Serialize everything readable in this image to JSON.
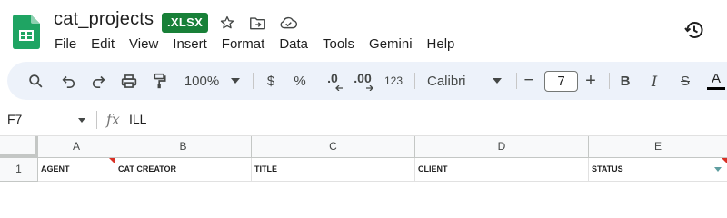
{
  "app": {
    "title": "cat_projects",
    "file_badge": ".XLSX",
    "icons": [
      "star-icon",
      "move-to-folder-icon",
      "cloud-status-icon",
      "version-history-icon"
    ]
  },
  "menu": [
    "File",
    "Edit",
    "View",
    "Insert",
    "Format",
    "Data",
    "Tools",
    "Gemini",
    "Help"
  ],
  "toolbar": {
    "zoom": "100%",
    "currency": "$",
    "percent": "%",
    "decrease_decimal": ".0",
    "increase_decimal": ".00",
    "more_formats": "123",
    "font": "Calibri",
    "font_size": "7",
    "decrease_size": "−",
    "increase_size": "+",
    "bold": "B",
    "italic": "I",
    "strikethrough": "S",
    "text_color": "A"
  },
  "formula_bar": {
    "cell_ref": "F7",
    "fx": "fx",
    "value": "ILL"
  },
  "grid": {
    "columns": [
      "A",
      "B",
      "C",
      "D",
      "E"
    ],
    "rows": [
      {
        "number": "1",
        "cells": [
          "AGENT",
          "CAT CREATOR",
          "TITLE",
          "CLIENT",
          "STATUS"
        ]
      }
    ]
  },
  "colors": {
    "sheets_green": "#188038",
    "toolbar_bg": "#edf2fa",
    "note_marker": "#d93025"
  }
}
